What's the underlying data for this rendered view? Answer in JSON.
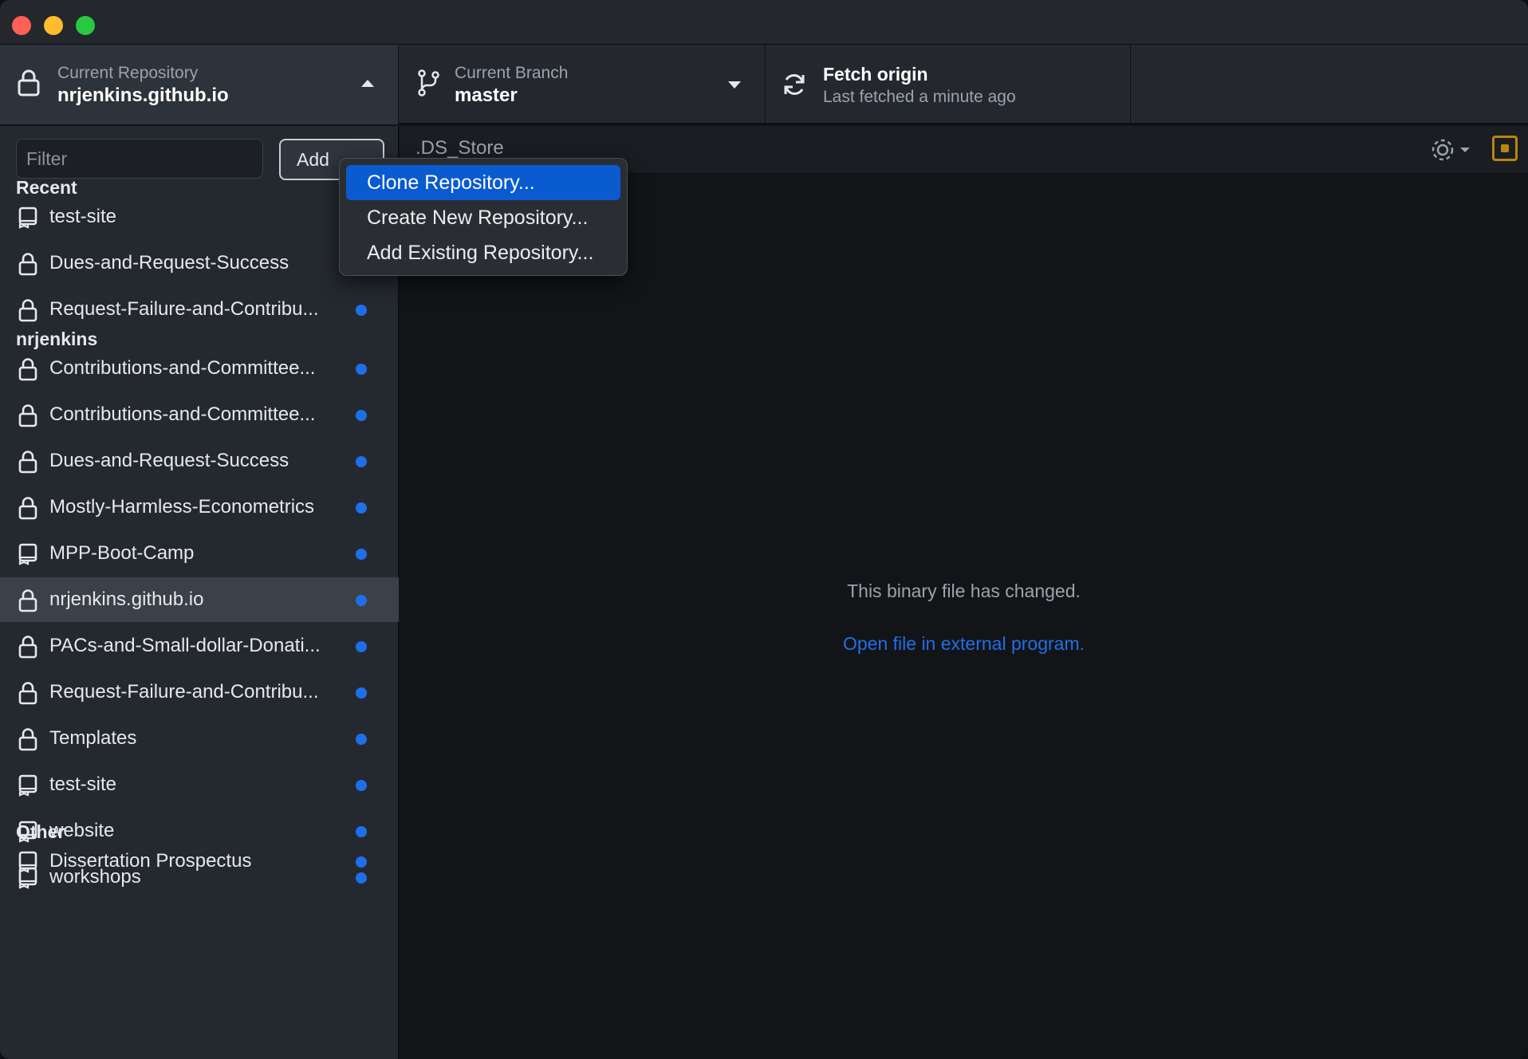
{
  "toolbar": {
    "repository": {
      "label": "Current Repository",
      "value": "nrjenkins.github.io"
    },
    "branch": {
      "label": "Current Branch",
      "value": "master"
    },
    "fetch": {
      "title": "Fetch origin",
      "subtitle": "Last fetched a minute ago"
    }
  },
  "sidebar": {
    "filter_placeholder": "Filter",
    "add_label": "Add",
    "groups": [
      {
        "header": "Recent",
        "items": [
          {
            "label": "test-site",
            "icon": "repo-icon",
            "dot": false
          },
          {
            "label": "Dues-and-Request-Success",
            "icon": "lock-icon",
            "dot": true
          },
          {
            "label": "Request-Failure-and-Contribu...",
            "icon": "lock-icon",
            "dot": true
          }
        ]
      },
      {
        "header": "nrjenkins",
        "items": [
          {
            "label": "Contributions-and-Committee...",
            "icon": "lock-icon",
            "dot": true
          },
          {
            "label": "Contributions-and-Committee...",
            "icon": "lock-icon",
            "dot": true
          },
          {
            "label": "Dues-and-Request-Success",
            "icon": "lock-icon",
            "dot": true
          },
          {
            "label": "Mostly-Harmless-Econometrics",
            "icon": "lock-icon",
            "dot": true
          },
          {
            "label": "MPP-Boot-Camp",
            "icon": "repo-icon",
            "dot": true
          },
          {
            "label": "nrjenkins.github.io",
            "icon": "lock-icon",
            "dot": true,
            "selected": true
          },
          {
            "label": "PACs-and-Small-dollar-Donati...",
            "icon": "lock-icon",
            "dot": true
          },
          {
            "label": "Request-Failure-and-Contribu...",
            "icon": "lock-icon",
            "dot": true
          },
          {
            "label": "Templates",
            "icon": "lock-icon",
            "dot": true
          },
          {
            "label": "test-site",
            "icon": "repo-icon",
            "dot": true
          },
          {
            "label": "website",
            "icon": "repo-icon",
            "dot": true
          },
          {
            "label": "workshops",
            "icon": "repo-icon",
            "dot": true
          }
        ]
      },
      {
        "header": "Other",
        "items": [
          {
            "label": "Dissertation Prospectus",
            "icon": "repo-icon",
            "dot": true
          }
        ]
      }
    ]
  },
  "main": {
    "file_name": ".DS_Store",
    "binary_message": "This binary file has changed.",
    "open_link": "Open file in external program."
  },
  "add_menu": {
    "items": [
      {
        "label": "Clone Repository...",
        "active": true
      },
      {
        "label": "Create New Repository...",
        "active": false
      },
      {
        "label": "Add Existing Repository...",
        "active": false
      }
    ]
  },
  "colors": {
    "accent": "#1f6feb",
    "menu_highlight": "#0a5bd0",
    "sidebar_bg": "#24292f",
    "selected_row": "#3b4049"
  }
}
